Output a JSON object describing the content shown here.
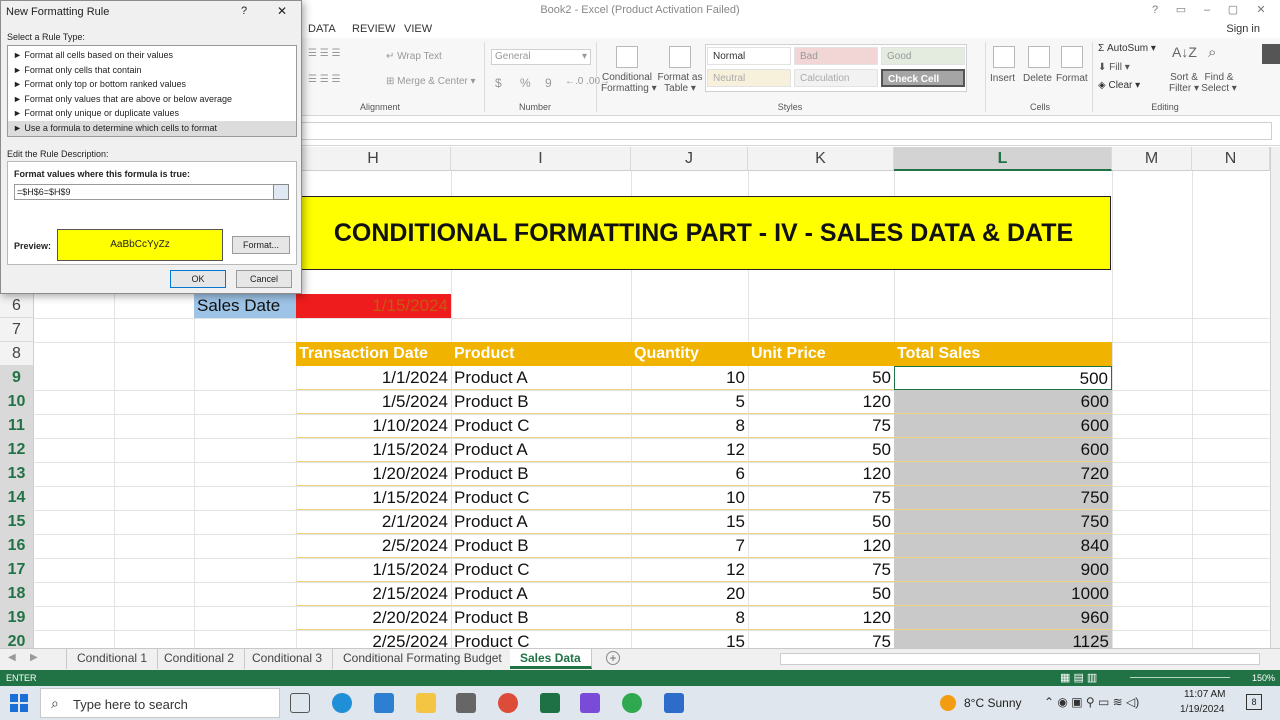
{
  "window": {
    "title": "Book2 - Excel (Product Activation Failed)",
    "signin": "Sign in",
    "ctrl": [
      "?",
      "▭",
      "–",
      "▢",
      "✕"
    ]
  },
  "ribbon": {
    "tabs": [
      "DATA",
      "REVIEW",
      "VIEW"
    ],
    "alignment": {
      "wrap": "Wrap Text",
      "merge": "Merge & Center",
      "label": "Alignment"
    },
    "number": {
      "format": "General",
      "label": "Number",
      "symbols": [
        "$",
        "%",
        "9"
      ]
    },
    "styles": {
      "cf1": "Conditional",
      "cf2": "Formatting",
      "fat1": "Format as",
      "fat2": "Table",
      "normal": "Normal",
      "bad": "Bad",
      "good": "Good",
      "neutral": "Neutral",
      "calculation": "Calculation",
      "check": "Check Cell",
      "label": "Styles"
    },
    "cells": {
      "insert": "Insert",
      "delete": "Delete",
      "format": "Format",
      "label": "Cells"
    },
    "editing": {
      "autosum": "AutoSum",
      "fill": "Fill",
      "clear": "Clear",
      "sort1": "Sort &",
      "sort2": "Filter",
      "find1": "Find &",
      "find2": "Select",
      "label": "Editing"
    }
  },
  "columns": [
    "H",
    "I",
    "J",
    "K",
    "L",
    "M",
    "N"
  ],
  "banner": "CONDITIONAL FORMATTING PART - IV - SALES DATA & DATE",
  "sales_date": {
    "label": "Sales Date",
    "value": "1/15/2024"
  },
  "headers": [
    "Transaction Date",
    "Product",
    "Quantity",
    "Unit Price",
    "Total Sales"
  ],
  "rows": [
    {
      "n": "9",
      "date": "1/1/2024",
      "product": "Product A",
      "qty": "10",
      "price": "50",
      "total": "500"
    },
    {
      "n": "10",
      "date": "1/5/2024",
      "product": "Product B",
      "qty": "5",
      "price": "120",
      "total": "600"
    },
    {
      "n": "11",
      "date": "1/10/2024",
      "product": "Product C",
      "qty": "8",
      "price": "75",
      "total": "600"
    },
    {
      "n": "12",
      "date": "1/15/2024",
      "product": "Product A",
      "qty": "12",
      "price": "50",
      "total": "600"
    },
    {
      "n": "13",
      "date": "1/20/2024",
      "product": "Product B",
      "qty": "6",
      "price": "120",
      "total": "720"
    },
    {
      "n": "14",
      "date": "1/15/2024",
      "product": "Product C",
      "qty": "10",
      "price": "75",
      "total": "750"
    },
    {
      "n": "15",
      "date": "2/1/2024",
      "product": "Product A",
      "qty": "15",
      "price": "50",
      "total": "750"
    },
    {
      "n": "16",
      "date": "2/5/2024",
      "product": "Product B",
      "qty": "7",
      "price": "120",
      "total": "840"
    },
    {
      "n": "17",
      "date": "1/15/2024",
      "product": "Product C",
      "qty": "12",
      "price": "75",
      "total": "900"
    },
    {
      "n": "18",
      "date": "2/15/2024",
      "product": "Product A",
      "qty": "20",
      "price": "50",
      "total": "1000"
    },
    {
      "n": "19",
      "date": "2/20/2024",
      "product": "Product B",
      "qty": "8",
      "price": "120",
      "total": "960"
    },
    {
      "n": "20",
      "date": "2/25/2024",
      "product": "Product C",
      "qty": "15",
      "price": "75",
      "total": "1125"
    }
  ],
  "row_numbers": {
    "r6": "6",
    "r7": "7",
    "r8": "8"
  },
  "sheets": [
    "Conditional 1",
    "Conditional 2",
    "Conditional 3",
    "Conditional Formating Budget",
    "Sales Data"
  ],
  "status": {
    "mode": "ENTER",
    "zoom": "150%"
  },
  "taskbar": {
    "search": "Type here to search",
    "weather": "8°C  Sunny",
    "time": "11:07 AM",
    "date": "1/19/2024",
    "notif": "8"
  },
  "dialog": {
    "title": "New Formatting Rule",
    "help": "?",
    "close": "✕",
    "select_label": "Select a Rule Type:",
    "rules": [
      "► Format all cells based on their values",
      "► Format only cells that contain",
      "► Format only top or bottom ranked values",
      "► Format only values that are above or below average",
      "► Format only unique or duplicate values",
      "► Use a formula to determine which cells to format"
    ],
    "edit_label": "Edit the Rule Description:",
    "formula_label": "Format values where this formula is true:",
    "formula": "=$H$6=$H$9",
    "preview_label": "Preview:",
    "preview_text": "AaBbCcYyZz",
    "format_btn": "Format...",
    "ok": "OK",
    "cancel": "Cancel"
  }
}
